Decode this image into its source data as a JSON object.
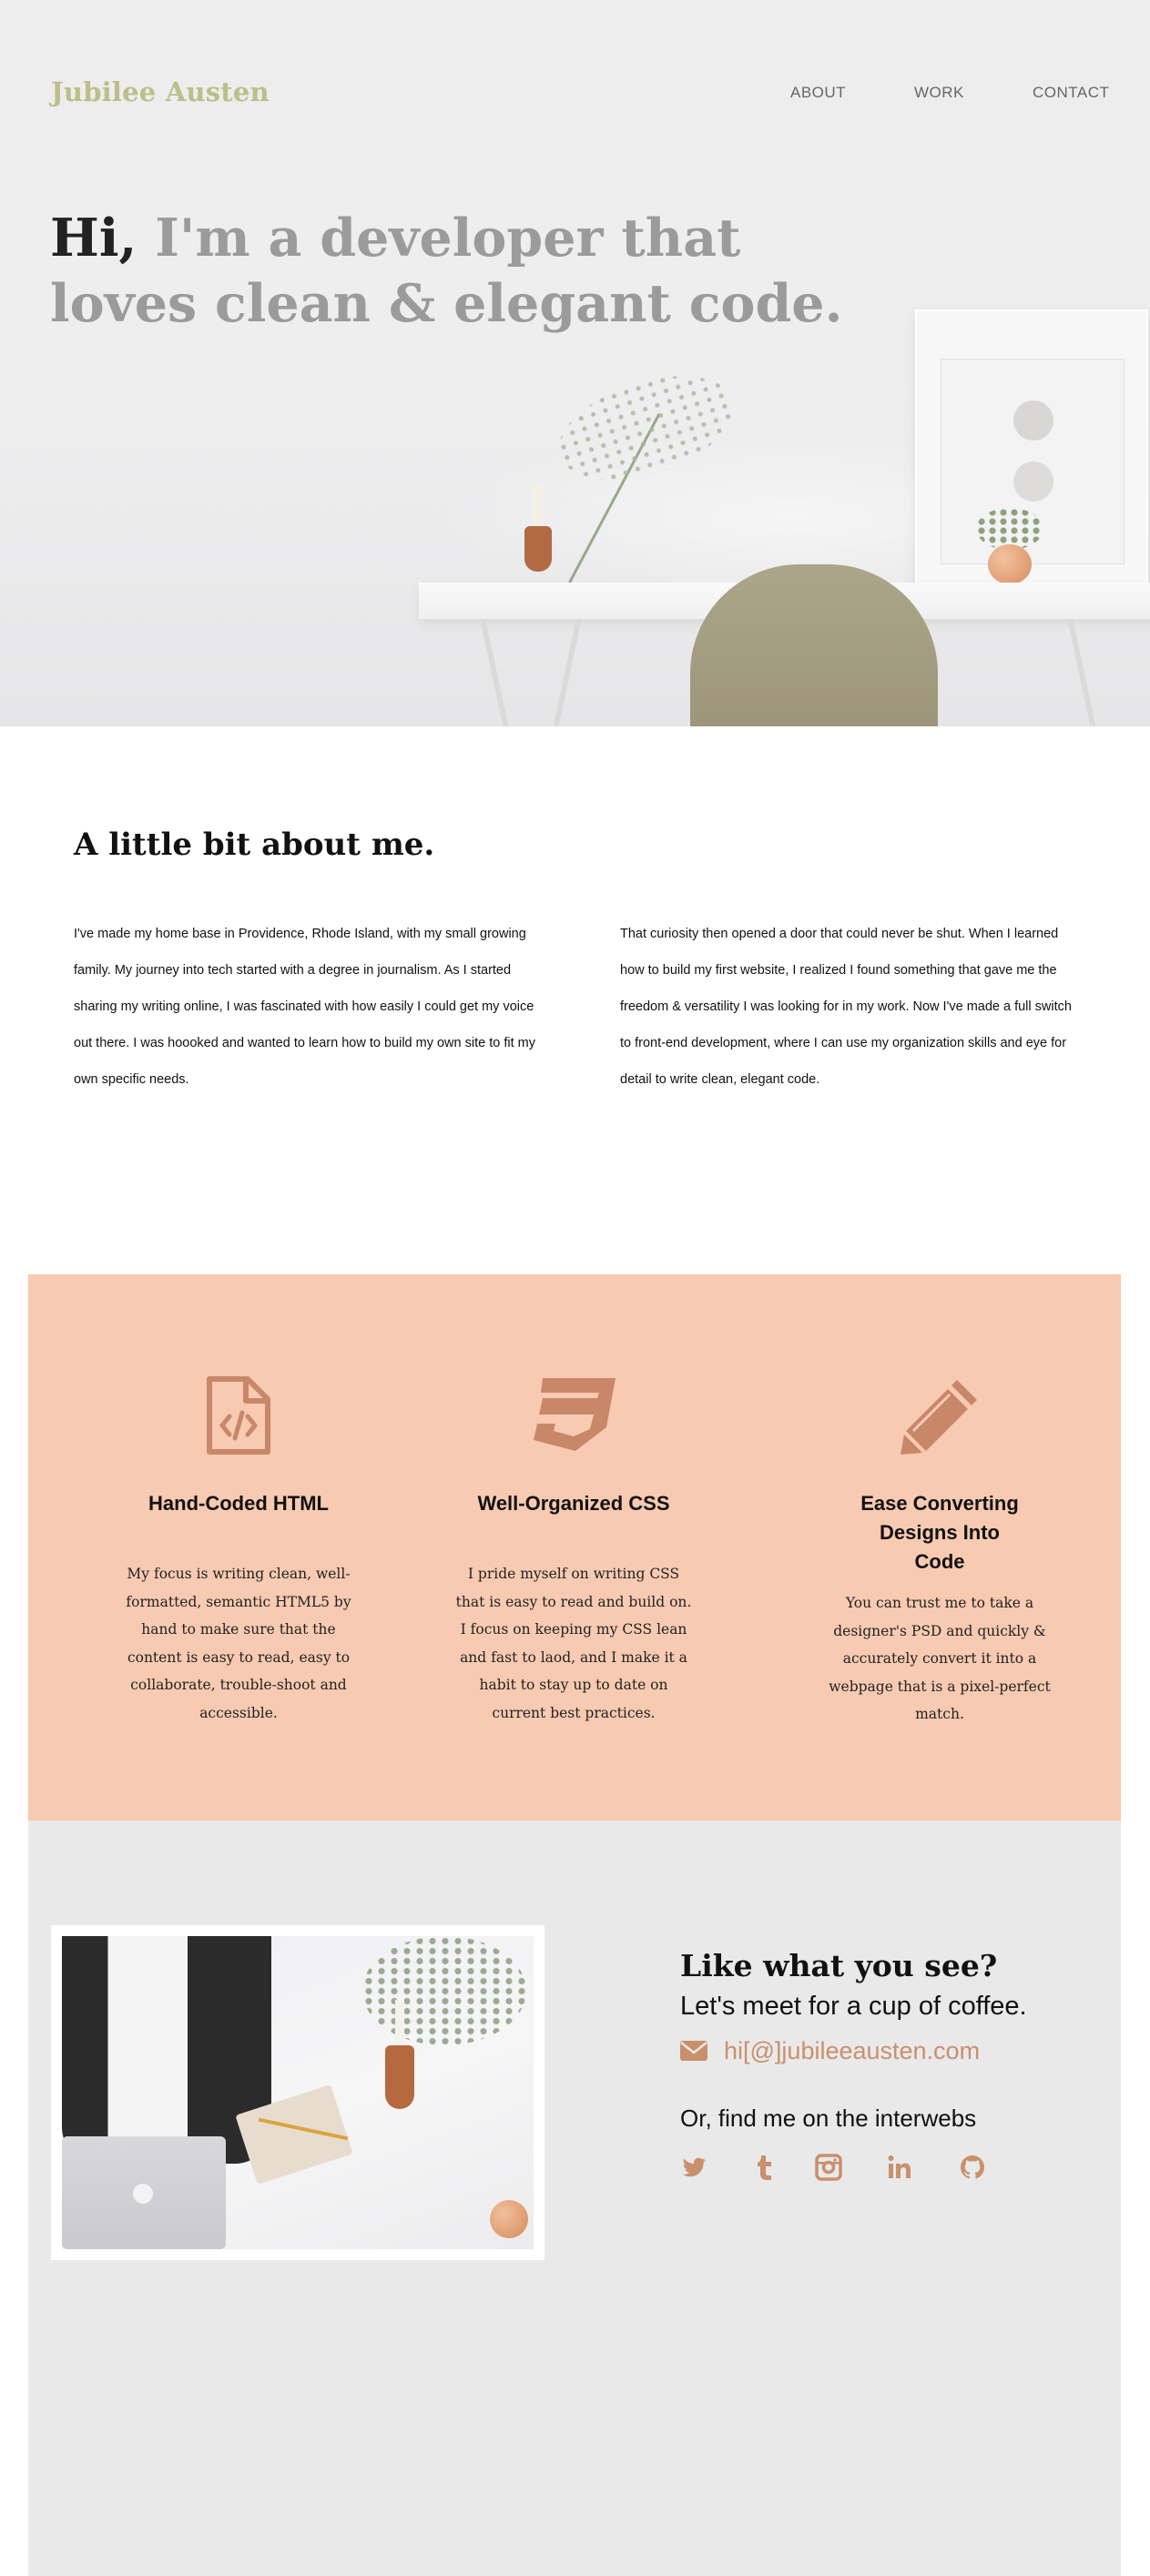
{
  "brand": {
    "name": "Jubilee Austen",
    "color": "#bcbf88"
  },
  "nav": {
    "items": [
      "ABOUT",
      "WORK",
      "CONTACT"
    ]
  },
  "hero": {
    "greeting": "Hi,",
    "headline": " I'm a developer that loves clean & elegant code."
  },
  "about": {
    "title": "A little bit about me.",
    "paragraphs": [
      "I've made my home base in Providence, Rhode Island, with my small growing family. My journey into tech started with a degree in journalism. As I started sharing my writing online, I was fascinated with how easily I could get my voice out there. I was hoooked and wanted to learn how to build my own site to fit my own specific needs.",
      "That curiosity then opened a door that could never be shut. When I learned how to build my first website, I realized I found something that gave me the freedom & versatility I was looking for in my work. Now I've made a full switch to front-end development, where I can use my organization skills and eye for detail to write clean, elegant code."
    ]
  },
  "skills": {
    "background": "#f7cab1",
    "icon_color": "#c9876a",
    "items": [
      {
        "icon": "html-file-code-icon",
        "title": "Hand-Coded HTML",
        "description": "My focus is writing clean, well-formatted, semantic HTML5 by hand to make sure that the content is easy to read, easy to collaborate, trouble-shoot and accessible."
      },
      {
        "icon": "css3-icon",
        "title": "Well-Organized CSS",
        "description": "I pride myself on writing CSS that is easy to read and build on. I focus on keeping my CSS lean and fast to laod, and I make it a habit to stay up to date on current best practices."
      },
      {
        "icon": "pencil-icon",
        "title": "Ease Converting Designs Into Code",
        "description": "You can trust me to take a designer's PSD and quickly & accurately convert it into a webpage that is a pixel-perfect match."
      }
    ]
  },
  "contact": {
    "heading": "Like what you see?",
    "subheading": "Let's meet for a cup of coffee.",
    "email": "hi[@]jubileeausten.com",
    "find_me": "Or, find me on the interwebs",
    "socials": [
      "twitter-icon",
      "tumblr-icon",
      "instagram-icon",
      "linkedin-icon",
      "github-icon"
    ],
    "accent": "#c9906c"
  }
}
